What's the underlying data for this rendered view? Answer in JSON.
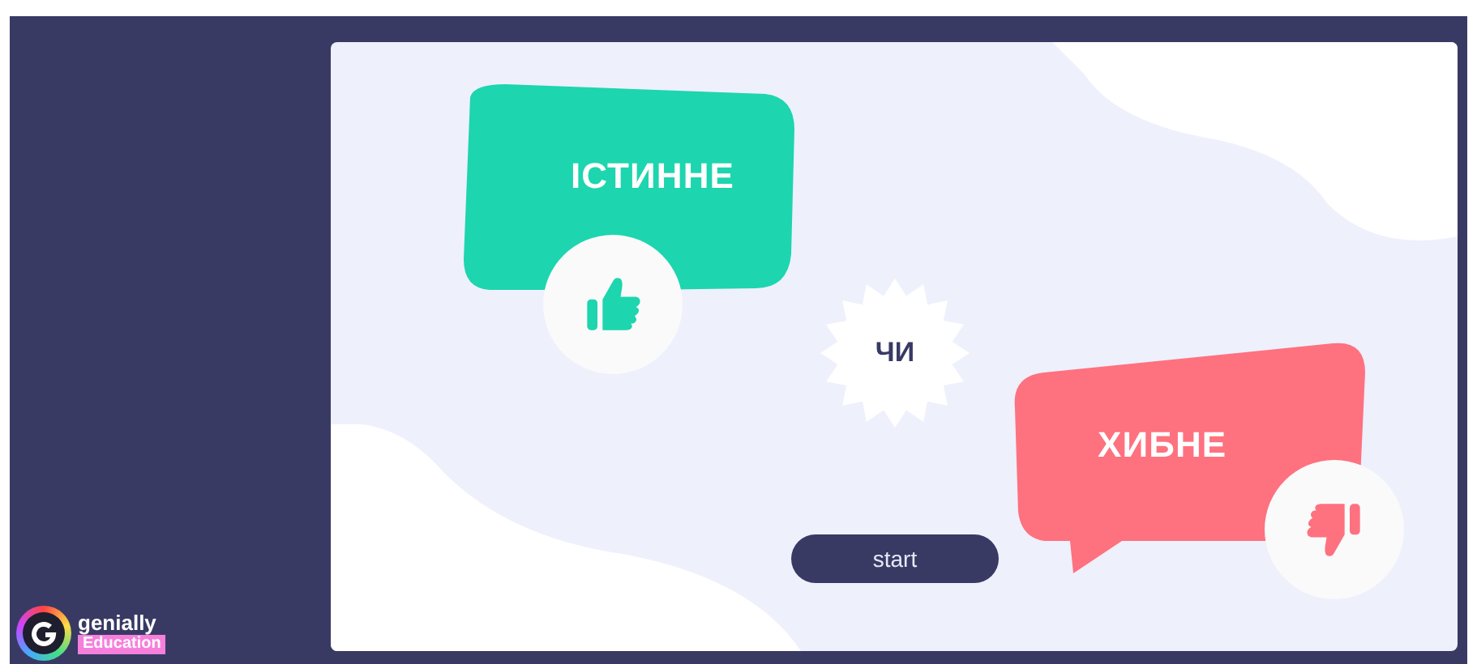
{
  "bubbles": [
    {
      "kind": "true",
      "label": "ІСТИННЕ"
    },
    {
      "kind": "false",
      "label": "ХИБНЕ"
    }
  ],
  "separator": "ЧИ",
  "start_button": "start",
  "logo": {
    "name": "genially",
    "badge": "Education"
  }
}
